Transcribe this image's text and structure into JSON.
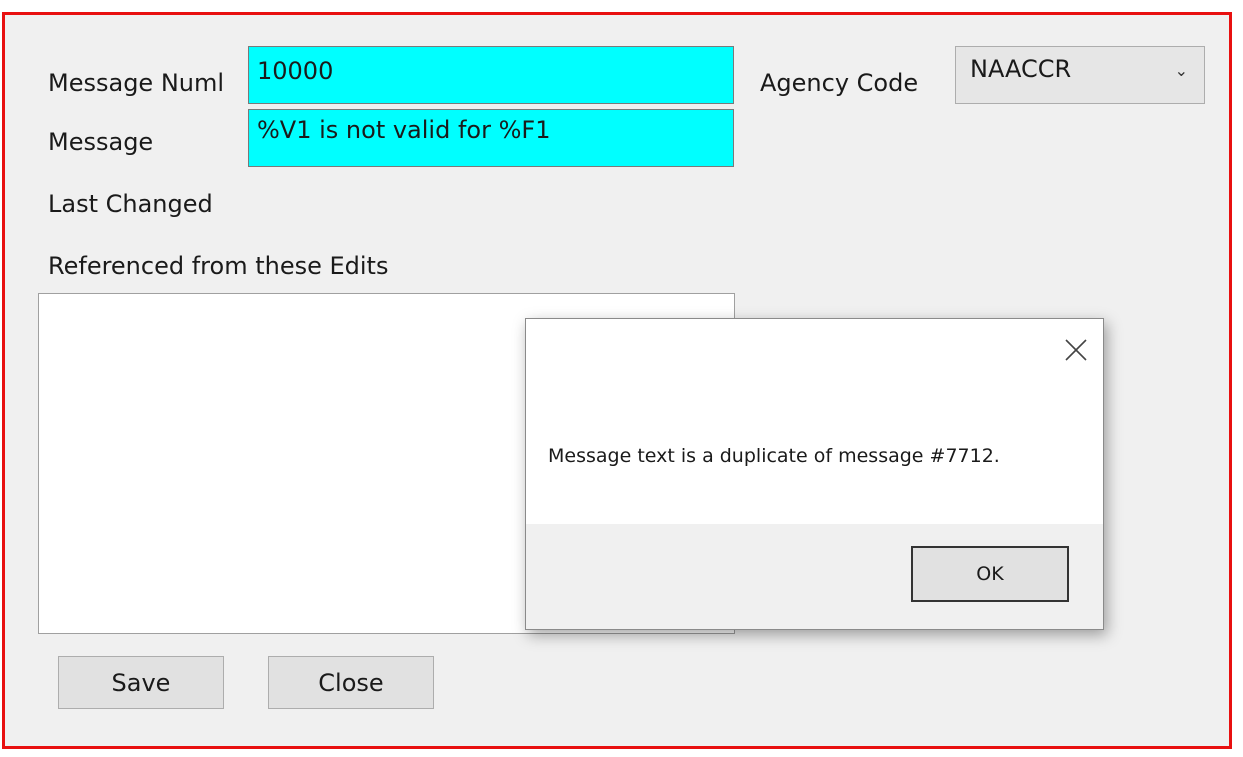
{
  "form": {
    "message_number_label": "Message Numl",
    "message_number_value": "10000",
    "message_label": "Message",
    "message_value": "%V1 is not valid for %F1",
    "agency_code_label": "Agency Code",
    "agency_code_value": "NAACCR",
    "last_changed_label": "Last Changed",
    "referenced_label": "Referenced from these Edits",
    "save_label": "Save",
    "close_label": "Close"
  },
  "dialog": {
    "message": "Message text is a duplicate of message #7712.",
    "ok_label": "OK",
    "close_icon": "close-icon"
  },
  "colors": {
    "frame_border": "#e81010",
    "field_highlight": "#00ffff"
  }
}
